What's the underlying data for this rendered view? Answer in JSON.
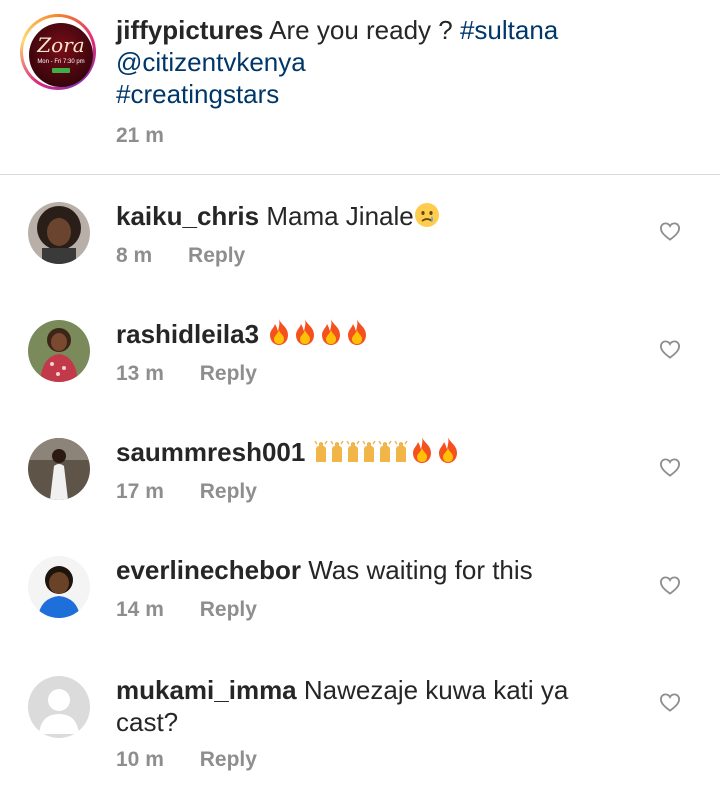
{
  "caption": {
    "username": "jiffypictures",
    "text": "Are you ready ?",
    "hashtag_1": "#sultana",
    "mention": "@citizentvkenya",
    "hashtag_2": "#creatingstars",
    "time": "21 m",
    "avatar_logo": "Zora",
    "avatar_sub": "Mon - Fri 7:30 pm"
  },
  "comments": [
    {
      "username": "kaiku_chris",
      "text": "Mama Jinale",
      "emoji": [
        "crying-face"
      ],
      "time": "8 m",
      "reply": "Reply"
    },
    {
      "username": "rashidleila3",
      "text": "",
      "emoji": [
        "fire",
        "fire",
        "fire",
        "fire"
      ],
      "time": "13 m",
      "reply": "Reply"
    },
    {
      "username": "saummresh001",
      "text": "",
      "emoji": [
        "raising-hands",
        "raising-hands",
        "raising-hands",
        "fire",
        "fire"
      ],
      "time": "17 m",
      "reply": "Reply"
    },
    {
      "username": "everlinechebor",
      "text": "Was waiting for this",
      "emoji": [],
      "time": "14 m",
      "reply": "Reply"
    },
    {
      "username": "mukami_imma",
      "text": "Nawezaje kuwa kati ya cast?",
      "emoji": [],
      "time": "10 m",
      "reply": "Reply"
    }
  ],
  "colors": {
    "text": "#262626",
    "secondary": "#8e8e8e",
    "link": "#00376b",
    "divider": "#dbdbdb",
    "fire": "#ff6a00"
  }
}
